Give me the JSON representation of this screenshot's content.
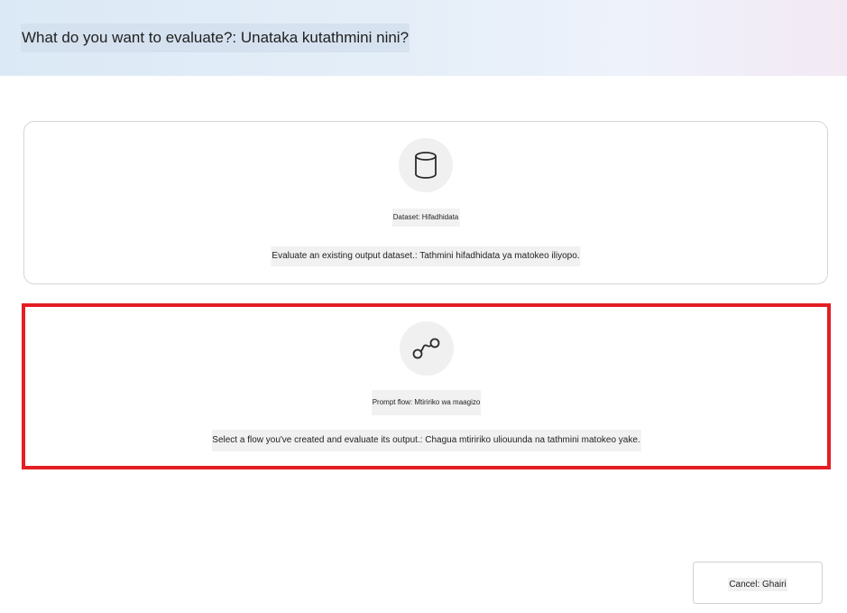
{
  "header": {
    "title": "What do you want to evaluate?: Unataka kutathmini nini?"
  },
  "options": [
    {
      "title": "Dataset: Hifadhidata",
      "description": "Evaluate an existing output dataset.: Tathmini hifadhidata ya matokeo iliyopo.",
      "icon": "database-icon",
      "selected": false
    },
    {
      "title": "Prompt flow: Mtiririko wa maagizo",
      "description": "Select a flow you've created and evaluate its output.: Chagua mtiririko uliouunda na tathmini matokeo yake.",
      "icon": "flow-icon",
      "selected": true
    }
  ],
  "footer": {
    "cancel_label": "Cancel: Ghairi"
  },
  "colors": {
    "selection_border": "#e31e24",
    "icon_background": "#f0f0f0",
    "card_border": "#d6d6d6"
  }
}
